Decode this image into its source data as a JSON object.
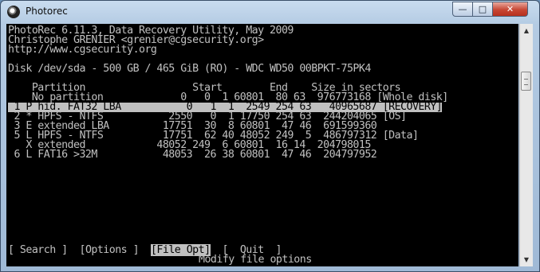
{
  "window": {
    "title": "Photorec",
    "app_icon": "photorec-disk-icon"
  },
  "controls": {
    "minimize": "—",
    "maximize": "□",
    "close": "✕"
  },
  "console": {
    "header": [
      "PhotoRec 6.11.3, Data Recovery Utility, May 2009",
      "Christophe GRENIER <grenier@cgsecurity.org>",
      "http://www.cgsecurity.org"
    ],
    "disk_line": "Disk /dev/sda - 500 GB / 465 GiB (RO) - WDC WD50 00BPKT-75PK4",
    "table_header": "    Partition                  Start        End    Size in sectors",
    "rows": [
      {
        "text": "    No partition             0   0  1 60801  80 63  976773168 [Whole disk]",
        "selected": false
      },
      {
        "text": " 1 P hid. FAT32 LBA           0   1  1  2549 254 63   40965687 [RECOVERY]",
        "selected": true
      },
      {
        "text": " 2 * HPFS - NTFS           2550   0  1 17750 254 63  244204065 [OS]",
        "selected": false
      },
      {
        "text": " 3 E extended LBA         17751  30  8 60801  47 46  691599360",
        "selected": false
      },
      {
        "text": " 5 L HPFS - NTFS          17751  62 40 48052 249  5  486797312 [Data]",
        "selected": false
      },
      {
        "text": "   X extended            48052 249  6 60801  16 14  204798015",
        "selected": false
      },
      {
        "text": " 6 L FAT16 >32M           48053  26 38 60801  47 46  204797952",
        "selected": false
      }
    ],
    "menu": {
      "search": "[ Search ]",
      "options": "[Options ]",
      "file_opt": "[File Opt]",
      "quit": "[  Quit  ]"
    },
    "menu_help": "Modify file options"
  }
}
